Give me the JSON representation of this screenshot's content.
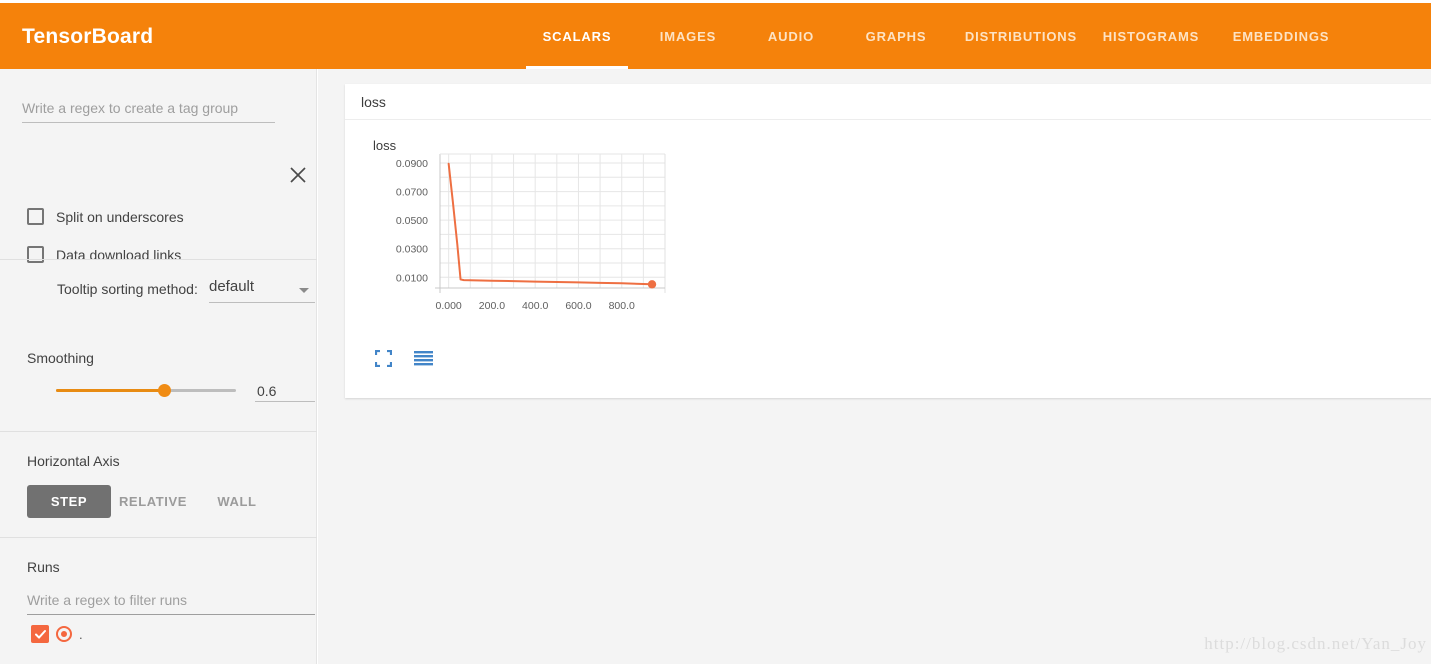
{
  "header": {
    "brand": "TensorBoard",
    "tabs": [
      {
        "label": "SCALARS",
        "active": true
      },
      {
        "label": "IMAGES",
        "active": false
      },
      {
        "label": "AUDIO",
        "active": false
      },
      {
        "label": "GRAPHS",
        "active": false
      },
      {
        "label": "DISTRIBUTIONS",
        "active": false
      },
      {
        "label": "HISTOGRAMS",
        "active": false
      },
      {
        "label": "EMBEDDINGS",
        "active": false
      }
    ],
    "accent_color": "#f5820b"
  },
  "sidebar": {
    "tag_filter": {
      "value": "",
      "placeholder": "Write a regex to create a tag group"
    },
    "clear_icon": "close-icon",
    "checkboxes": [
      {
        "label": "Split on underscores",
        "checked": false
      },
      {
        "label": "Data download links",
        "checked": false
      }
    ],
    "tooltip": {
      "label": "Tooltip sorting method:",
      "value": "default"
    },
    "smoothing": {
      "title": "Smoothing",
      "value": "0.6",
      "percent": 60
    },
    "horizontal_axis": {
      "title": "Horizontal Axis",
      "options": [
        {
          "label": "STEP",
          "active": true
        },
        {
          "label": "RELATIVE",
          "active": false
        },
        {
          "label": "WALL",
          "active": false
        }
      ]
    },
    "runs": {
      "title": "Runs",
      "filter": {
        "value": "",
        "placeholder": "Write a regex to filter runs"
      },
      "items": [
        {
          "name": ".",
          "checked": true,
          "color": "#f4673f"
        }
      ]
    }
  },
  "main": {
    "card_title": "loss",
    "chart_title": "loss",
    "tools": [
      {
        "icon": "fullscreen-icon",
        "color": "#4285c8"
      },
      {
        "icon": "data-table-icon",
        "color": "#4285c8"
      }
    ]
  },
  "watermark": "http://blog.csdn.net/Yan_Joy",
  "chart_data": {
    "type": "line",
    "title": "loss",
    "xlabel": "",
    "ylabel": "",
    "series": [
      {
        "name": ".",
        "color": "#ee6f42",
        "x": [
          0,
          20,
          40,
          55,
          70,
          100,
          200,
          300,
          400,
          500,
          600,
          700,
          800,
          900,
          940
        ],
        "y": [
          0.0895,
          0.062,
          0.033,
          0.0085,
          0.008,
          0.0079,
          0.0076,
          0.0073,
          0.007,
          0.0067,
          0.0064,
          0.0061,
          0.0058,
          0.0053,
          0.0051
        ]
      }
    ],
    "xlim": [
      -40,
      1000
    ],
    "ylim": [
      0.0025,
      0.0963
    ],
    "xticks": [
      0,
      200,
      400,
      600,
      800
    ],
    "xtick_labels": [
      "0.000",
      "200.0",
      "400.0",
      "600.0",
      "800.0"
    ],
    "yticks": [
      0.01,
      0.03,
      0.05,
      0.07,
      0.09
    ],
    "ytick_labels": [
      "0.0100",
      "0.0300",
      "0.0500",
      "0.0700",
      "0.0900"
    ],
    "grid": true,
    "legend": false,
    "last_point_marker": {
      "x": 940,
      "y": 0.0051
    }
  }
}
